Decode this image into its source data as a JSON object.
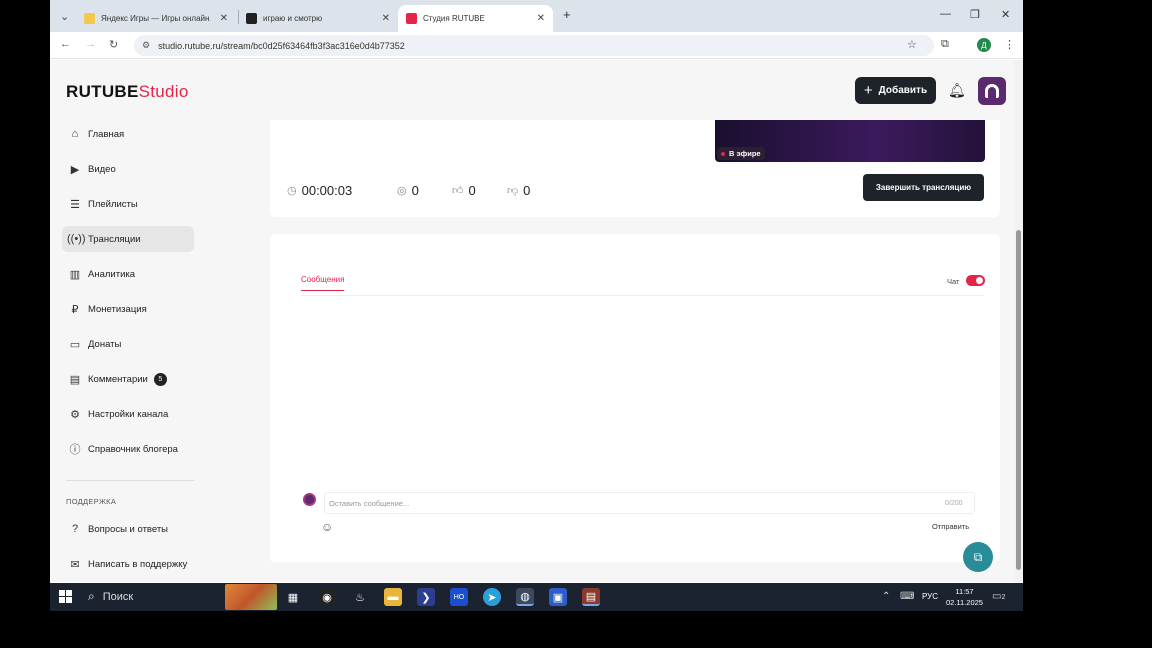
{
  "browser": {
    "tabs": [
      {
        "title": "Яндекс Игры — Игры онлайн",
        "favicon_color": "#f2c94c"
      },
      {
        "title": "играю и смотрю",
        "favicon_color": "#222222"
      },
      {
        "title": "Студия RUTUBE",
        "favicon_color": "#e5244a",
        "active": true
      }
    ],
    "new_tab": "+",
    "url": "studio.rutube.ru/stream/bc0d25f63464fb3f3ac316e0d4b77352",
    "profile_letter": "Д"
  },
  "header": {
    "logo_main": "RUTUBE",
    "logo_studio": "Studio",
    "add_button": "Добавить"
  },
  "sidebar": {
    "items": [
      {
        "label": "Главная",
        "icon": "home-icon"
      },
      {
        "label": "Видео",
        "icon": "video-icon"
      },
      {
        "label": "Плейлисты",
        "icon": "playlist-icon"
      },
      {
        "label": "Трансляции",
        "icon": "broadcast-icon",
        "active": true
      },
      {
        "label": "Аналитика",
        "icon": "analytics-icon"
      },
      {
        "label": "Монетизация",
        "icon": "ruble-icon"
      },
      {
        "label": "Донаты",
        "icon": "wallet-icon"
      },
      {
        "label": "Комментарии",
        "icon": "comment-icon",
        "badge": "5"
      },
      {
        "label": "Настройки канала",
        "icon": "gear-icon"
      },
      {
        "label": "Справочник блогера",
        "icon": "info-icon"
      }
    ],
    "support_heading": "ПОДДЕРЖКА",
    "support_items": [
      {
        "label": "Вопросы и ответы",
        "icon": "question-icon"
      },
      {
        "label": "Написать в поддержку",
        "icon": "mail-icon"
      }
    ]
  },
  "stream": {
    "live_label": "В эфире",
    "duration": "00:00:03",
    "viewers": "0",
    "likes": "0",
    "dislikes": "0",
    "end_button": "Завершить трансляцию"
  },
  "chat": {
    "tab_messages": "Сообщения",
    "toggle_label": "Чат",
    "toggle_on": true,
    "input_placeholder": "Оставить сообщение...",
    "counter": "0/200",
    "send_button": "Отправить"
  },
  "taskbar": {
    "search_label": "Поиск",
    "lang": "РУС",
    "time": "11:57",
    "date": "02.11.2025",
    "notification_count": "2"
  },
  "colors": {
    "accent": "#e5244a",
    "dark_button": "#1e2329"
  }
}
